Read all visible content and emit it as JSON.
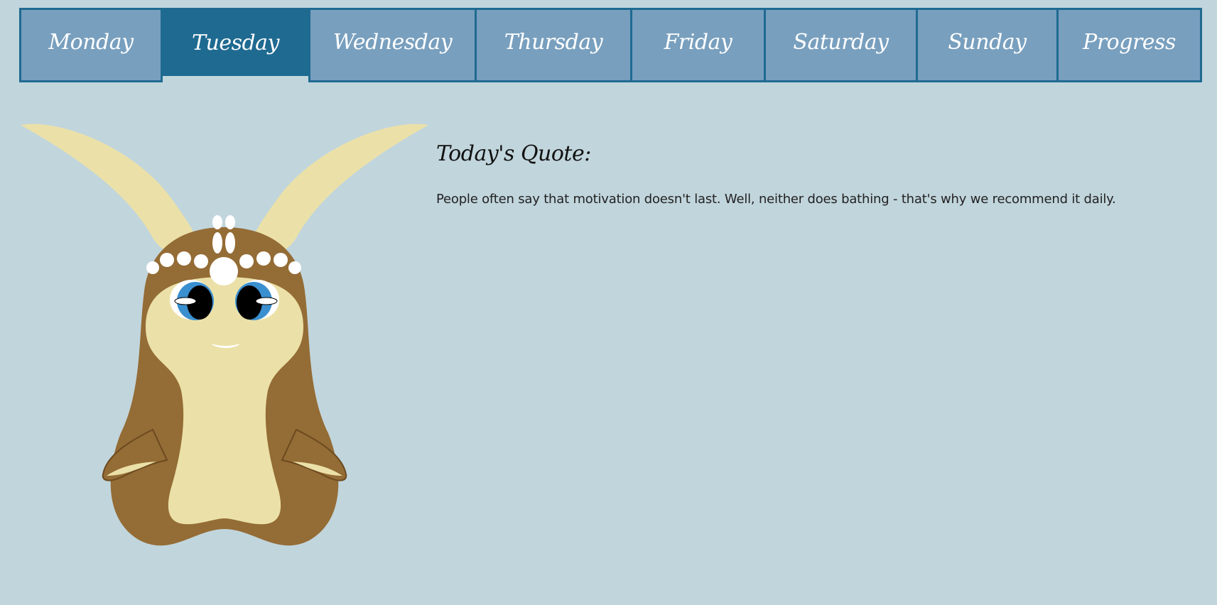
{
  "nav": {
    "tabs": [
      {
        "label": "Monday",
        "active": false
      },
      {
        "label": "Tuesday",
        "active": true
      },
      {
        "label": "Wednesday",
        "active": false
      },
      {
        "label": "Thursday",
        "active": false
      },
      {
        "label": "Friday",
        "active": false
      },
      {
        "label": "Saturday",
        "active": false
      },
      {
        "label": "Sunday",
        "active": false
      },
      {
        "label": "Progress",
        "active": false
      }
    ]
  },
  "quote": {
    "heading": "Today's Quote:",
    "text": "People often say that motivation doesn't last. Well, neither does bathing - that's why we recommend it daily."
  },
  "colors": {
    "background": "#c1d5dc",
    "tab_inactive": "#789fbe",
    "tab_active": "#1f6a91",
    "tab_border": "#1f6a91",
    "creature_body": "#946c35",
    "creature_belly": "#ebe1a8",
    "eye_iris": "#3a8fcf"
  },
  "mascot": {
    "icon": "slug-creature-icon"
  }
}
